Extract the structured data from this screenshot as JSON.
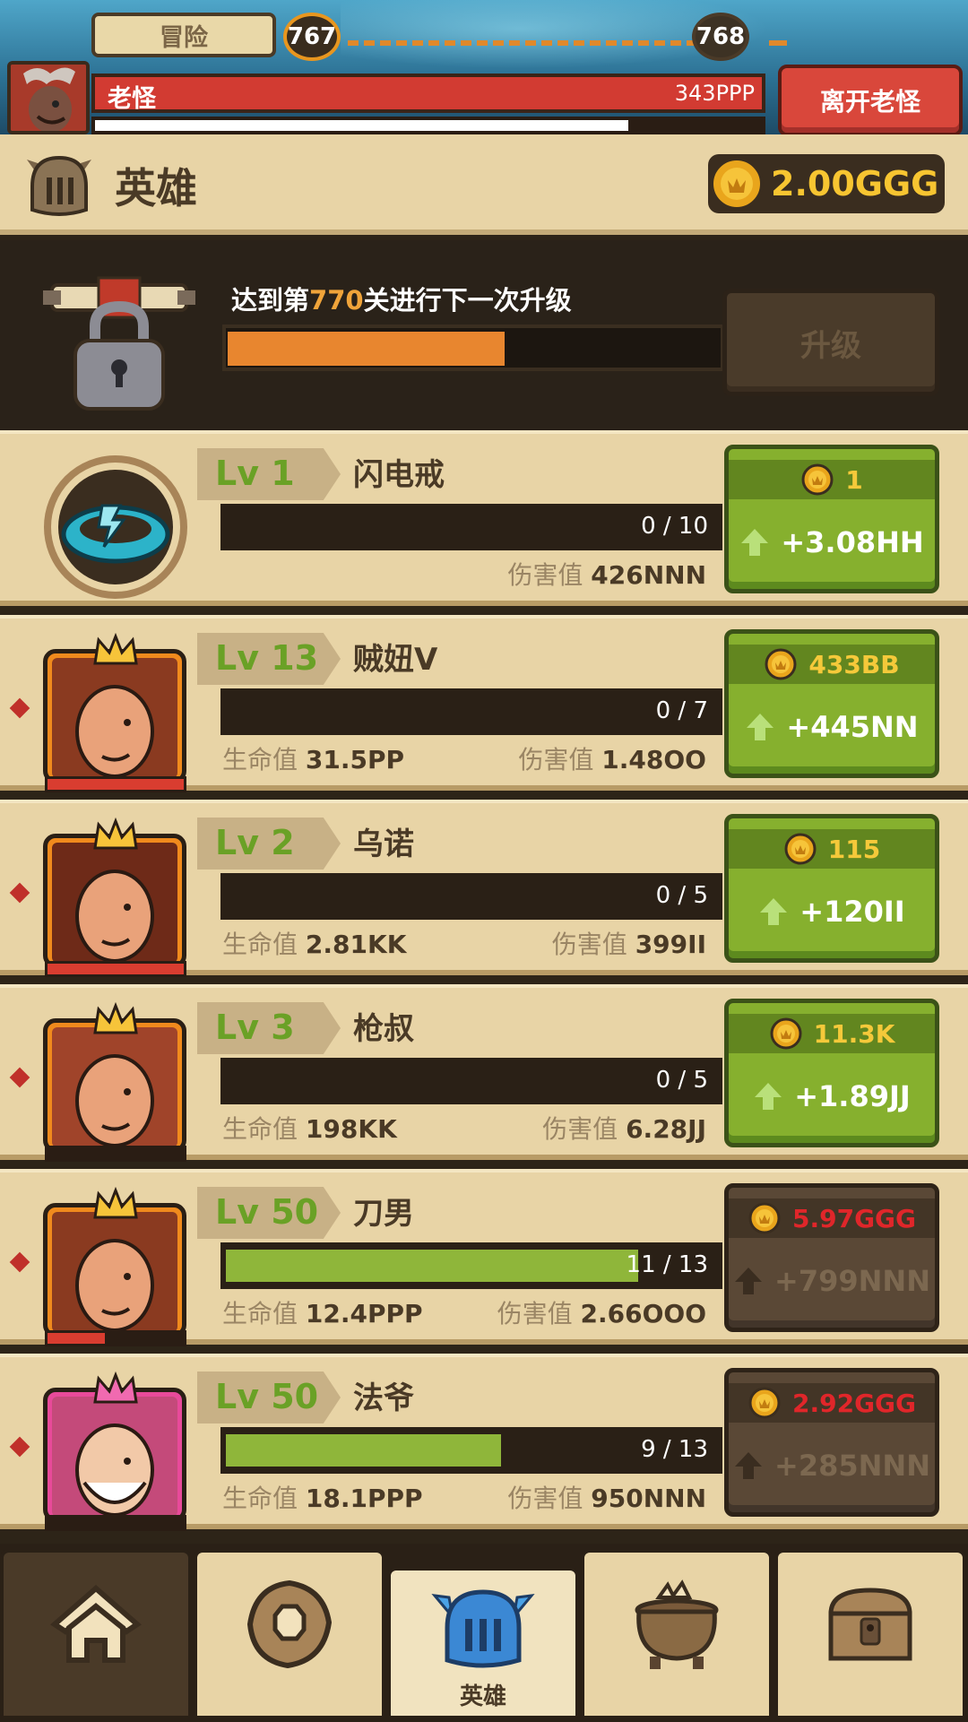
{
  "battle": {
    "mode_label": "冒险",
    "current_stage": "767",
    "next_stage": "768",
    "boss_name": "老怪",
    "boss_hp": "343PPP",
    "boss_timer": 0.8,
    "leave_button": "离开老怪"
  },
  "header": {
    "title": "英雄",
    "gold": "2.00GGG"
  },
  "unlock": {
    "text_prefix": "达到第",
    "stage": "770",
    "text_suffix": "关进行下一次升级",
    "progress": 0.56,
    "button": "升级"
  },
  "labels": {
    "hp": "生命值",
    "dmg": "伤害值"
  },
  "heroes": [
    {
      "name": "闪电戒",
      "level": "Lv 1",
      "progress_text": "0 / 10",
      "progress": 0,
      "hp": "",
      "dmg": "426NNN",
      "cost": "1",
      "gain": "+3.08HH",
      "affordable": true,
      "icon": "lightning-ring-icon"
    },
    {
      "name": "贼妞V",
      "level": "Lv 13",
      "progress_text": "0 / 7",
      "progress": 0,
      "hp": "31.5PP",
      "dmg": "1.48OO",
      "cost": "433BB",
      "gain": "+445NN",
      "affordable": true,
      "icon": "hero-thief-girl",
      "health": 1
    },
    {
      "name": "乌诺",
      "level": "Lv 2",
      "progress_text": "0 / 5",
      "progress": 0,
      "hp": "2.81KK",
      "dmg": "399II",
      "cost": "115",
      "gain": "+120II",
      "affordable": true,
      "icon": "hero-uno",
      "health": 1
    },
    {
      "name": "枪叔",
      "level": "Lv 3",
      "progress_text": "0 / 5",
      "progress": 0,
      "hp": "198KK",
      "dmg": "6.28JJ",
      "cost": "11.3K",
      "gain": "+1.89JJ",
      "affordable": true,
      "icon": "hero-gun-uncle",
      "health": 0
    },
    {
      "name": "刀男",
      "level": "Lv 50",
      "progress_text": "11 / 13",
      "progress": 0.84,
      "hp": "12.4PPP",
      "dmg": "2.66OOO",
      "cost": "5.97GGG",
      "gain": "+799NNN",
      "affordable": false,
      "icon": "hero-blade-man",
      "health": 0.42
    },
    {
      "name": "法爷",
      "level": "Lv 50",
      "progress_text": "9 / 13",
      "progress": 0.56,
      "hp": "18.1PPP",
      "dmg": "950NNN",
      "cost": "2.92GGG",
      "gain": "+285NNN",
      "affordable": false,
      "icon": "hero-wizard",
      "health": 0
    }
  ],
  "nav": {
    "items": [
      {
        "icon": "home-icon",
        "label": ""
      },
      {
        "icon": "settings-nut-icon",
        "label": ""
      },
      {
        "icon": "hero-helmet-icon",
        "label": "英雄"
      },
      {
        "icon": "cauldron-icon",
        "label": ""
      },
      {
        "icon": "treasure-chest-icon",
        "label": ""
      }
    ]
  },
  "colors": {
    "accent_green": "#86b02e",
    "gold": "#f7c531",
    "red": "#d23b32",
    "orange": "#e8862f"
  }
}
